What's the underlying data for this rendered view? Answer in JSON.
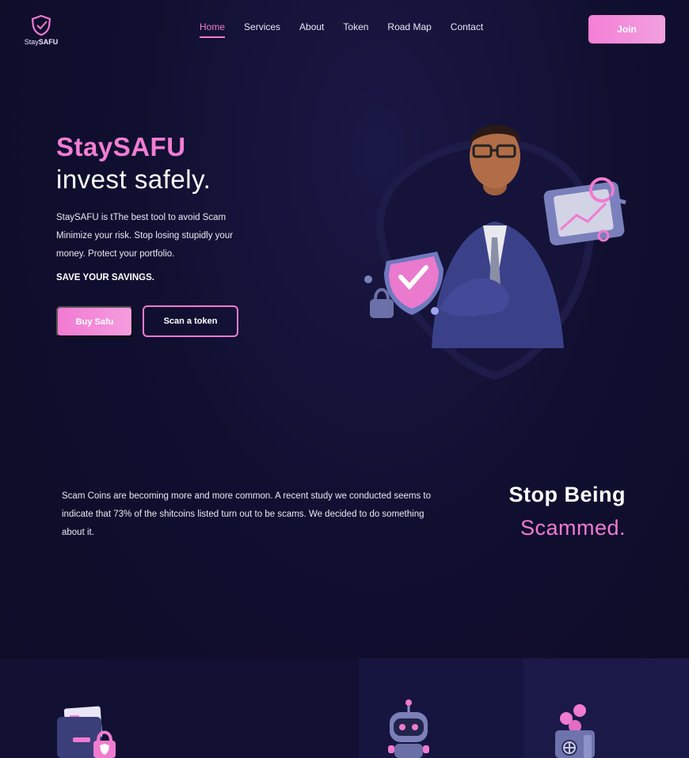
{
  "brand": {
    "name_prefix": "Stay",
    "name_bold": "SAFU"
  },
  "nav": {
    "items": [
      {
        "label": "Home",
        "active": true
      },
      {
        "label": "Services",
        "active": false
      },
      {
        "label": "About",
        "active": false
      },
      {
        "label": "Token",
        "active": false
      },
      {
        "label": "Road Map",
        "active": false
      },
      {
        "label": "Contact",
        "active": false
      }
    ],
    "join_label": "Join"
  },
  "hero": {
    "title_line1": "StaySAFU",
    "title_line2": "invest safely.",
    "description": "StaySAFU is tThe best tool to avoid Scam Minimize your risk. Stop losing stupidly your money. Protect your portfolio.",
    "tagline": "SAVE YOUR SAVINGS.",
    "buy_button": "Buy Safu",
    "scan_button": "Scan a token"
  },
  "section2": {
    "text": "Scam Coins are becoming more and more common. A recent study we conducted seems to indicate that 73% of the shitcoins listed turn out to be scams. We decided to do something about it.",
    "heading_line1": "Stop Being",
    "heading_line2": "Scammed."
  },
  "colors": {
    "background": "#0f0d2a",
    "accent_pink": "#f07bd0",
    "text": "#ffffff"
  },
  "features": [
    {
      "icon": "wallet-lock-icon"
    },
    {
      "icon": "robot-icon"
    },
    {
      "icon": "safe-coins-icon"
    }
  ]
}
